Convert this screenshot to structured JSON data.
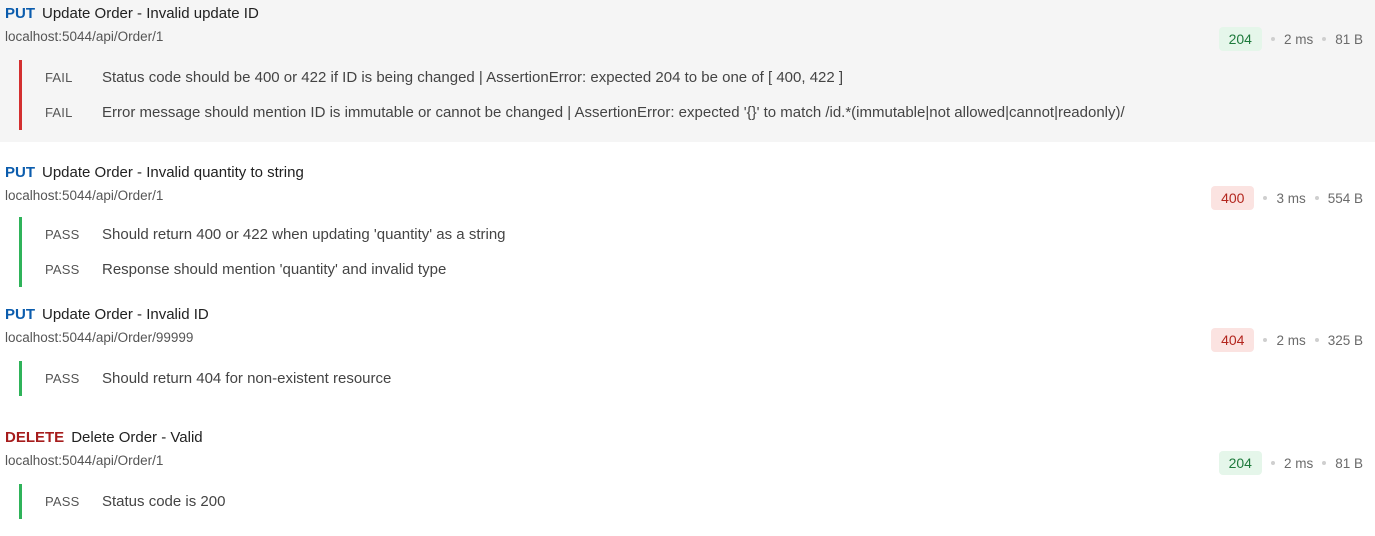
{
  "requests": [
    {
      "method": "PUT",
      "name": "Update Order - Invalid update ID",
      "url": "localhost:5044/api/Order/1",
      "status_code": "204",
      "time": "2 ms",
      "size": "81 B",
      "tests": [
        {
          "status": "FAIL",
          "text": "Status code should be 400 or 422 if ID is being changed | AssertionError: expected 204 to be one of [ 400, 422 ]"
        },
        {
          "status": "FAIL",
          "text": "Error message should mention ID is immutable or cannot be changed | AssertionError: expected '{}' to match /id.*(immutable|not allowed|cannot|readonly)/"
        }
      ]
    },
    {
      "method": "PUT",
      "name": "Update Order - Invalid quantity to string",
      "url": "localhost:5044/api/Order/1",
      "status_code": "400",
      "time": "3 ms",
      "size": "554 B",
      "tests": [
        {
          "status": "PASS",
          "text": "Should return 400 or 422 when updating 'quantity' as a string"
        },
        {
          "status": "PASS",
          "text": "Response should mention 'quantity' and invalid type"
        }
      ]
    },
    {
      "method": "PUT",
      "name": "Update Order - Invalid ID",
      "url": "localhost:5044/api/Order/99999",
      "status_code": "404",
      "time": "2 ms",
      "size": "325 B",
      "tests": [
        {
          "status": "PASS",
          "text": "Should return 404 for non-existent resource"
        }
      ]
    },
    {
      "method": "DELETE",
      "name": "Delete Order - Valid",
      "url": "localhost:5044/api/Order/1",
      "status_code": "204",
      "time": "2 ms",
      "size": "81 B",
      "tests": [
        {
          "status": "PASS",
          "text": "Status code is 200"
        }
      ]
    }
  ],
  "colors": {
    "put": "#0b5cad",
    "delete": "#a61c1c",
    "fail": "#d32f2f",
    "pass": "#2fb35a",
    "status_ok_bg": "#e5f6ea",
    "status_err_bg": "#fbe3e1"
  }
}
